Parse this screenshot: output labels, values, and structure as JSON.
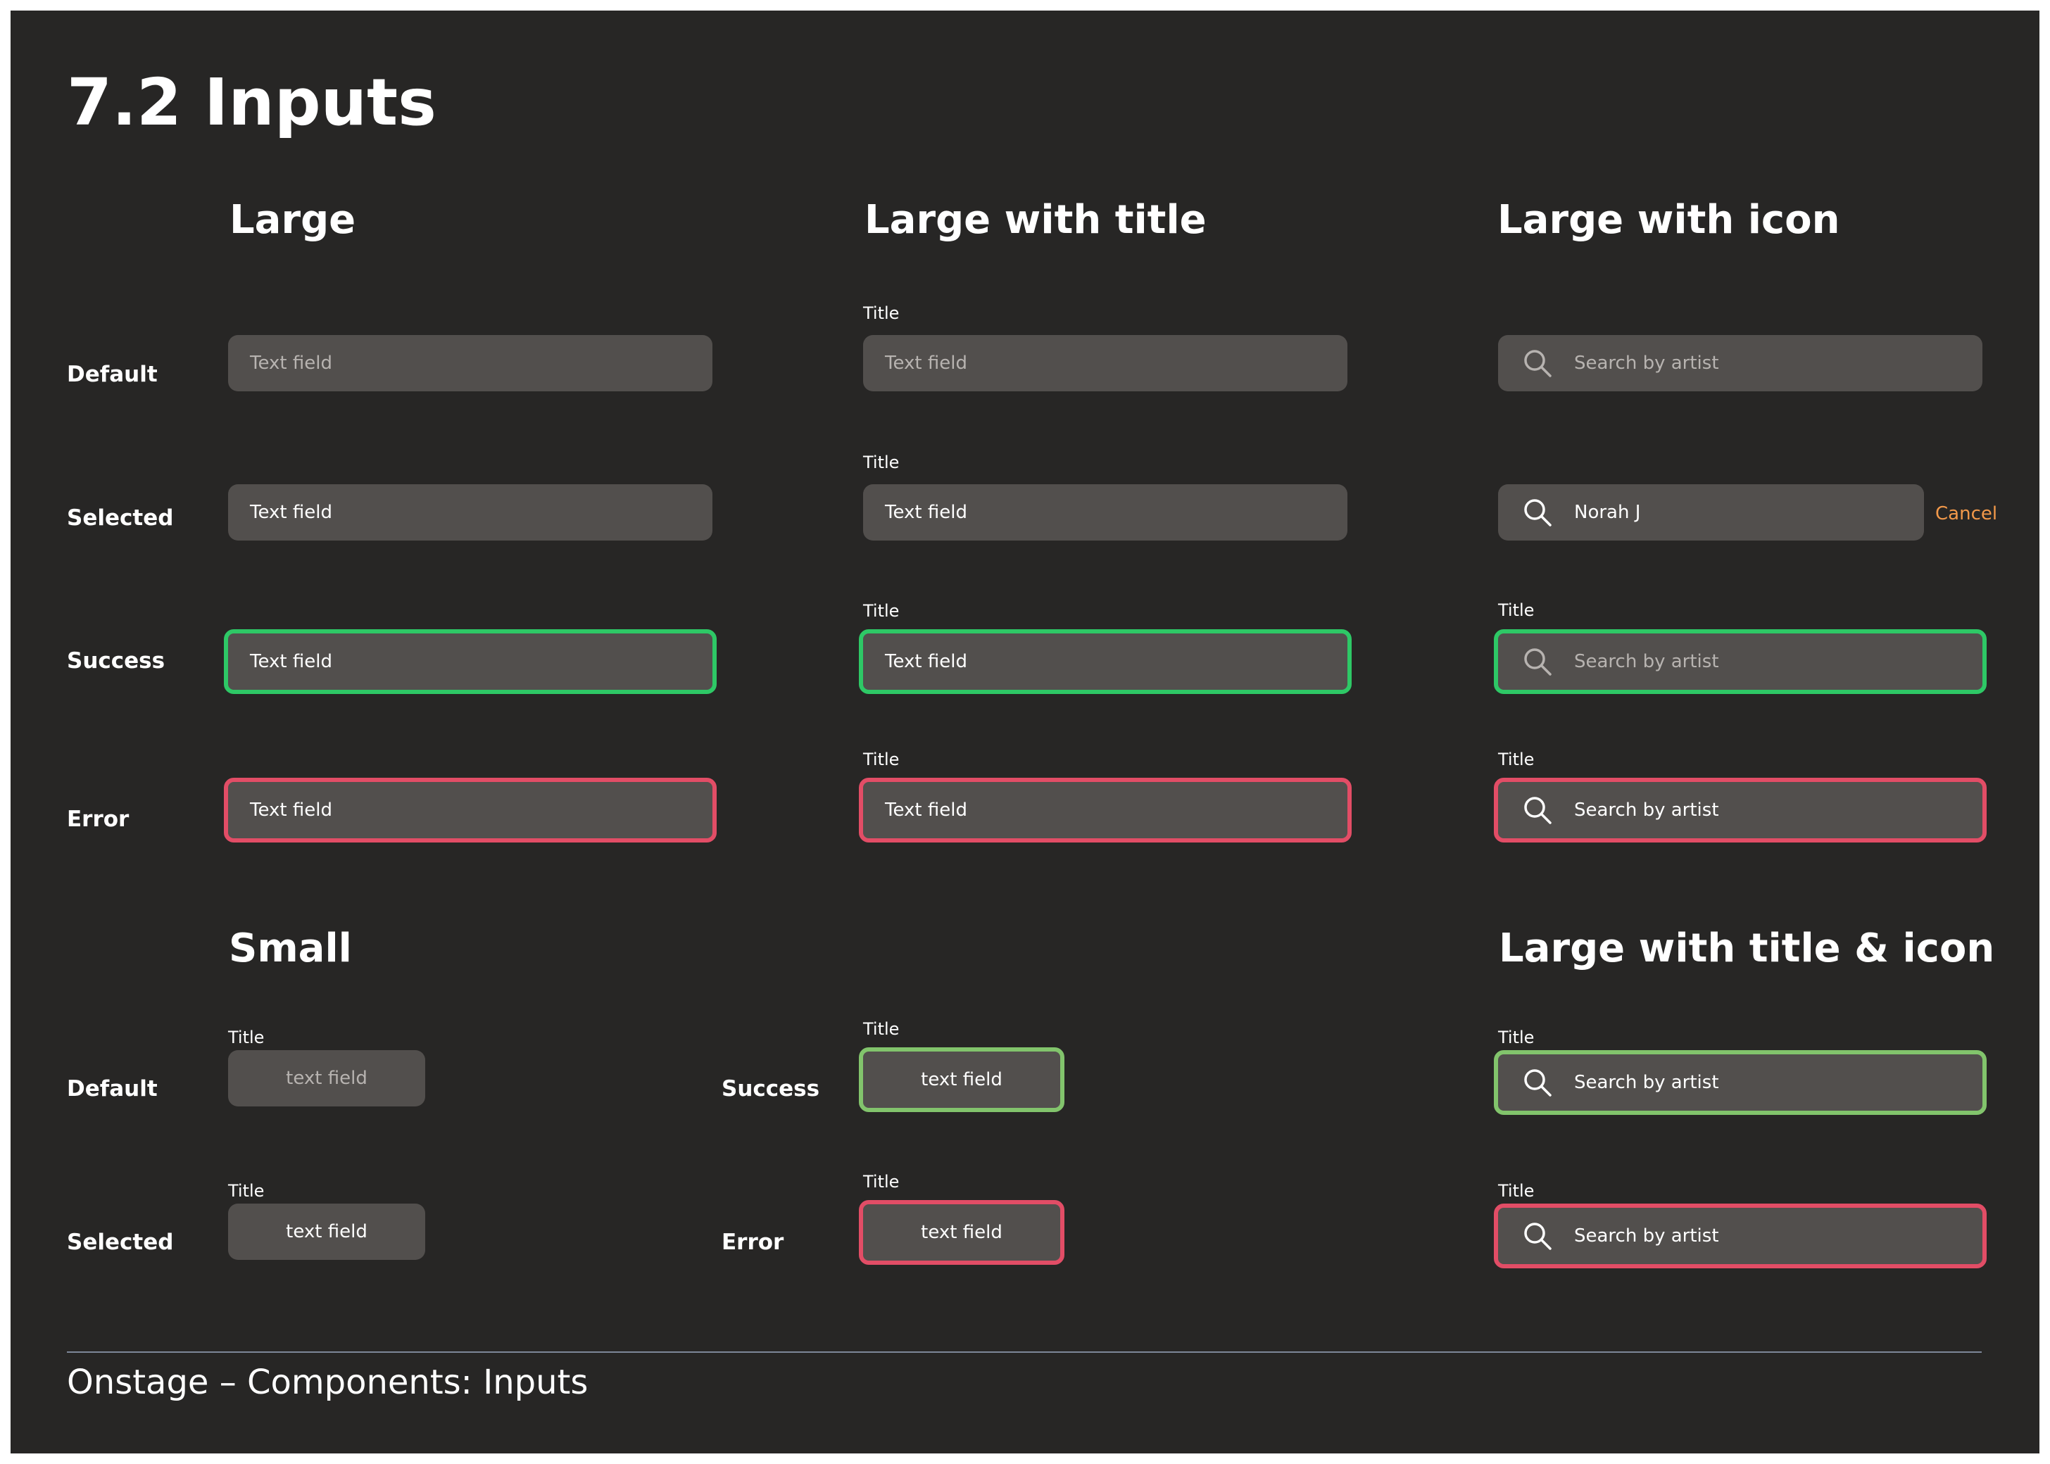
{
  "page": {
    "title": "7.2 Inputs",
    "footer": "Onstage – Components: Inputs"
  },
  "colors": {
    "background": "#272625",
    "field": "#524f4d",
    "success": "#2ec866",
    "success_alt": "#82c46c",
    "error": "#e24d66",
    "accent": "#f2994a"
  },
  "sections": {
    "large": "Large",
    "large_with_title": "Large with title",
    "large_with_icon": "Large with icon",
    "small": "Small",
    "large_with_title_icon": "Large with title & icon"
  },
  "row_labels": {
    "default": "Default",
    "selected": "Selected",
    "success": "Success",
    "error": "Error"
  },
  "fields": {
    "title": "Title",
    "text_field": "Text field",
    "small_text_field": "text field",
    "search_placeholder": "Search by artist",
    "search_value": "Norah J",
    "cancel": "Cancel",
    "icon": "search-icon"
  }
}
